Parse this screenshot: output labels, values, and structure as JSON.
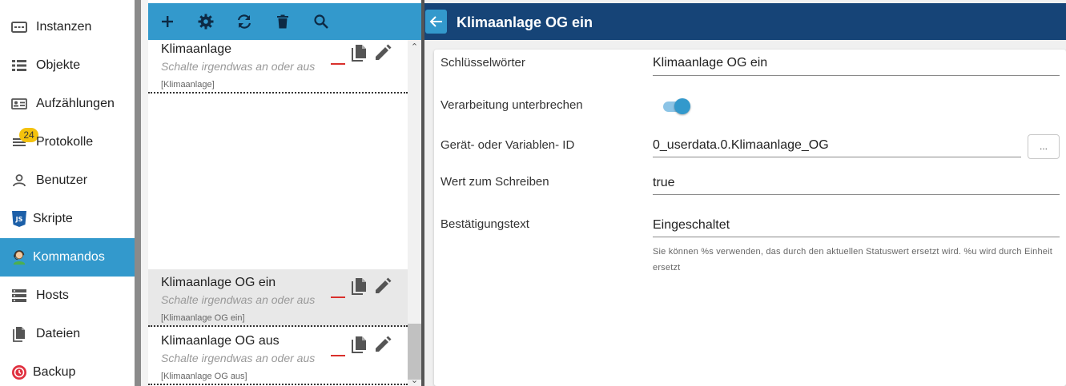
{
  "nav": {
    "items": [
      {
        "label": "Instanzen",
        "icon": "instances-icon"
      },
      {
        "label": "Objekte",
        "icon": "objects-list-icon"
      },
      {
        "label": "Aufzählungen",
        "icon": "enums-icon"
      },
      {
        "label": "Protokolle",
        "icon": "logs-icon",
        "badge": "24"
      },
      {
        "label": "Benutzer",
        "icon": "user-icon"
      },
      {
        "label": "Skripte",
        "icon": "js-icon"
      },
      {
        "label": "Kommandos",
        "icon": "commands-icon",
        "active": true
      },
      {
        "label": "Hosts",
        "icon": "hosts-icon"
      },
      {
        "label": "Dateien",
        "icon": "files-icon"
      },
      {
        "label": "Backup",
        "icon": "backup-icon"
      }
    ]
  },
  "toolbar": {
    "buttons": [
      "add-icon",
      "settings-icon",
      "refresh-icon",
      "delete-icon",
      "search-icon"
    ]
  },
  "commands": [
    {
      "name": "Klimaanlage",
      "desc": "Schalte irgendwas an oder aus",
      "tag": "[Klimaanlage]",
      "selected": false
    },
    {
      "name": "Klimaanlage OG ein",
      "desc": "Schalte irgendwas an oder aus",
      "tag": "[Klimaanlage OG ein]",
      "selected": true
    },
    {
      "name": "Klimaanlage OG aus",
      "desc": "Schalte irgendwas an oder aus",
      "tag": "[Klimaanlage OG aus]",
      "selected": false
    }
  ],
  "detail": {
    "title": "Klimaanlage OG ein",
    "fields": {
      "keywords": {
        "label": "Schlüsselwörter",
        "value": "Klimaanlage OG ein"
      },
      "break": {
        "label": "Verarbeitung unterbrechen",
        "value": true
      },
      "device": {
        "label": "Gerät- oder Variablen- ID",
        "value": "0_userdata.0.Klimaanlage_OG",
        "button": "..."
      },
      "write": {
        "label": "Wert zum Schreiben",
        "value": "true"
      },
      "confirm": {
        "label": "Bestätigungstext",
        "value": "Eingeschaltet"
      }
    },
    "help": "Sie können %s verwenden, das durch den aktuellen Statuswert ersetzt wird. %u wird durch Einheit ersetzt"
  },
  "colors": {
    "accent": "#3399cc",
    "header": "#164477",
    "remove_dash": "#d9302c",
    "badge": "#f4c20d"
  }
}
